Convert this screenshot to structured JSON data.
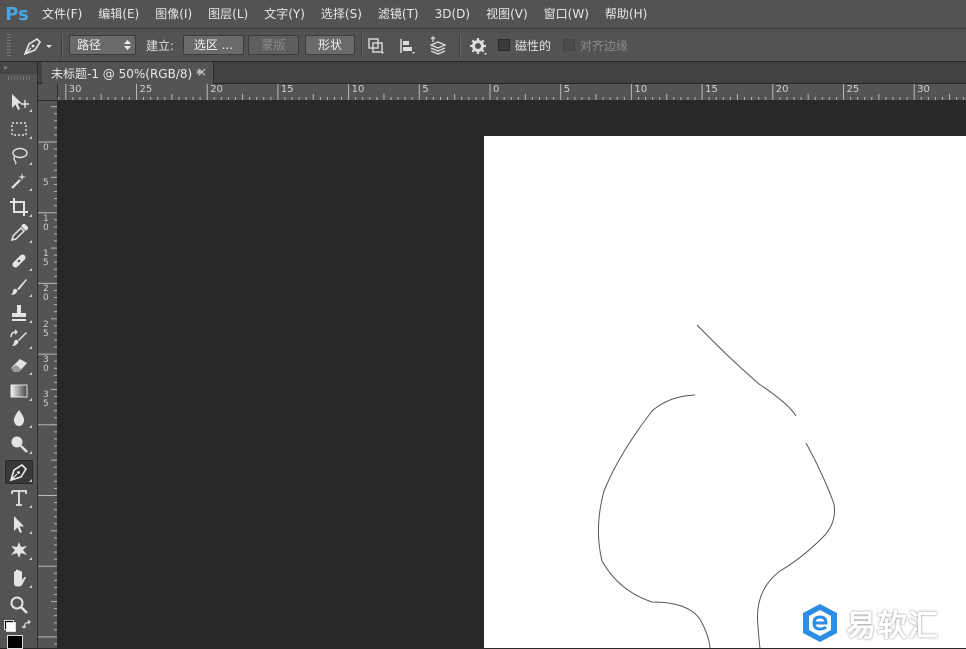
{
  "app": {
    "logo": "Ps"
  },
  "menu": [
    "文件(F)",
    "编辑(E)",
    "图像(I)",
    "图层(L)",
    "文字(Y)",
    "选择(S)",
    "滤镜(T)",
    "3D(D)",
    "视图(V)",
    "窗口(W)",
    "帮助(H)"
  ],
  "options": {
    "tool_icon": "pen-icon",
    "mode_select": "路径",
    "make_label": "建立:",
    "selection_button": "选区 ...",
    "mask_button": "蒙版",
    "shape_button": "形状",
    "magnetic_label": "磁性的",
    "align_edges_label": "对齐边缘"
  },
  "document": {
    "tab_title": "未标题-1 @ 50%(RGB/8) *",
    "close": "×"
  },
  "rulers": {
    "horizontal": [
      "30",
      "25",
      "20",
      "15",
      "10",
      "5",
      "0",
      "5",
      "10",
      "15",
      "20",
      "25",
      "30"
    ],
    "vertical": [
      "0",
      "5",
      "10",
      "15",
      "20",
      "25",
      "30",
      "35"
    ]
  },
  "tools": [
    "move-icon",
    "marquee-icon",
    "lasso-icon",
    "magic-wand-icon",
    "crop-icon",
    "eyedropper-icon",
    "healing-brush-icon",
    "brush-icon",
    "clone-stamp-icon",
    "history-brush-icon",
    "eraser-icon",
    "gradient-icon",
    "blur-icon",
    "dodge-icon",
    "pen-icon",
    "type-icon",
    "path-selection-icon",
    "custom-shape-icon",
    "hand-icon",
    "zoom-icon"
  ],
  "watermark": {
    "text": "易软汇",
    "logo": "brand-logo-icon"
  },
  "colors": {
    "ps_blue": "#4aa4e8",
    "panel": "#535353",
    "pasteboard": "#282828",
    "canvas": "#ffffff",
    "watermark_blue": "#2b8de6"
  }
}
